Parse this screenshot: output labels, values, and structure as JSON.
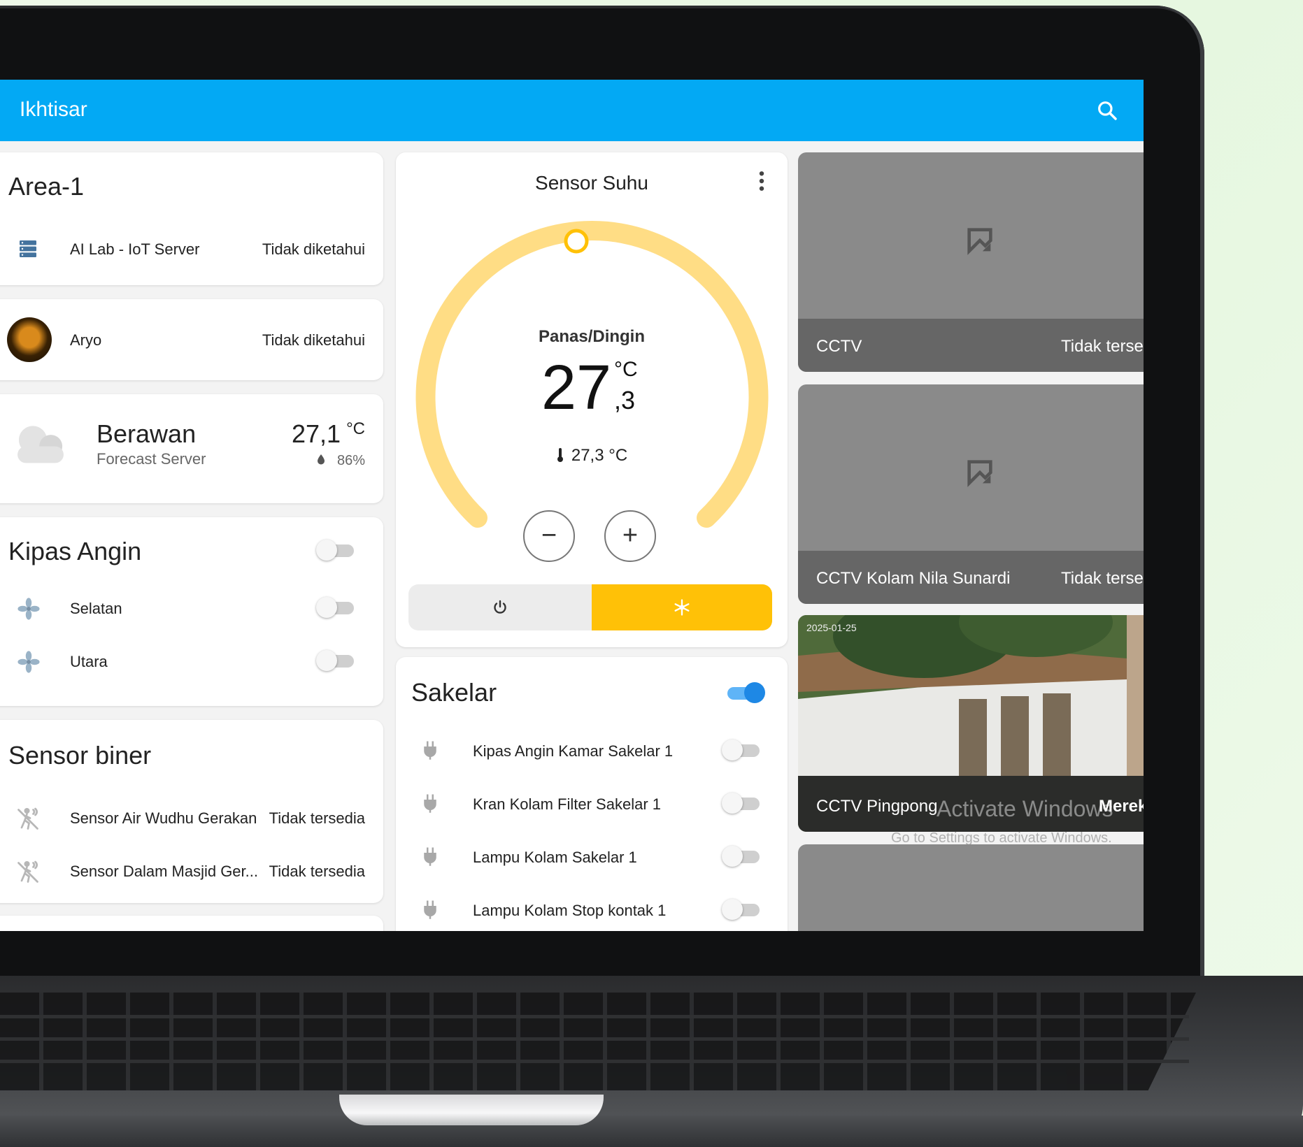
{
  "header": {
    "title": "Ikhtisar",
    "search_icon": "search-icon"
  },
  "area_card": {
    "title": "Area-1",
    "rows": [
      {
        "label": "AI Lab - IoT Server",
        "state": "Tidak diketahui",
        "icon": "server-icon"
      }
    ]
  },
  "person_card": {
    "label": "Aryo",
    "state": "Tidak diketahui"
  },
  "weather_card": {
    "condition": "Berawan",
    "source": "Forecast Server",
    "temperature": "27,1",
    "temperature_unit": "°C",
    "humidity": "86%"
  },
  "fan_card": {
    "title": "Kipas Angin",
    "master_on": false,
    "rows": [
      {
        "label": "Selatan",
        "on": false
      },
      {
        "label": "Utara",
        "on": false
      }
    ]
  },
  "binary_card": {
    "title": "Sensor biner",
    "rows": [
      {
        "label": "Sensor Air Wudhu Gerakan",
        "state": "Tidak tersedia"
      },
      {
        "label": "Sensor Dalam Masjid Ger...",
        "state": "Tidak tersedia"
      }
    ]
  },
  "thermostat": {
    "title": "Sensor Suhu",
    "mode_label": "Panas/Dingin",
    "target_integer": "27",
    "target_decimal": ",3",
    "unit": "°C",
    "current_temp": "27,3 °C",
    "minus_label": "−",
    "plus_label": "+",
    "power_icon": "power-icon",
    "heat_cool_icon": "sun-snowflake-icon",
    "accent": "#ffc107",
    "arc_color": "#ffdd85"
  },
  "switch_card": {
    "title": "Sakelar",
    "master_on": true,
    "rows": [
      {
        "label": "Kipas Angin Kamar Sakelar 1",
        "on": false
      },
      {
        "label": "Kran Kolam Filter Sakelar 1",
        "on": false
      },
      {
        "label": "Lampu Kolam Sakelar 1",
        "on": false
      },
      {
        "label": "Lampu Kolam Stop kontak 1",
        "on": false
      }
    ]
  },
  "cameras": [
    {
      "name": "CCTV",
      "state": "Tidak tersedia"
    },
    {
      "name": "CCTV Kolam Nila Sunardi",
      "state": "Tidak tersedia"
    },
    {
      "name": "CCTV Pingpong",
      "state": "Merekam",
      "timestamp": "2025-01-25",
      "watermark": "Activate Windows",
      "watermark_sub": "Go to Settings to activate Windows."
    }
  ]
}
